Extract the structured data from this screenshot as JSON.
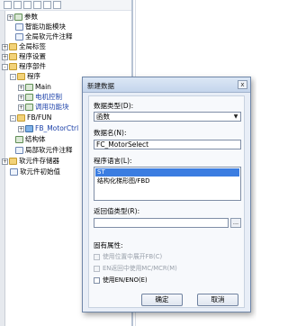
{
  "tree": {
    "items": [
      {
        "label": "参数",
        "depth": 1,
        "expander": "+",
        "icon": "grid-icon"
      },
      {
        "label": "智能功能模块",
        "depth": 1,
        "expander": "",
        "icon": "module-icon"
      },
      {
        "label": "全局软元件注释",
        "depth": 1,
        "expander": "",
        "icon": "doc-icon"
      },
      {
        "label": "全局标签",
        "depth": 0,
        "expander": "+",
        "icon": "folder-icon"
      },
      {
        "label": "程序设置",
        "depth": 0,
        "expander": "+",
        "icon": "folder-icon"
      },
      {
        "label": "程序部件",
        "depth": 0,
        "expander": "-",
        "icon": "folder-icon"
      },
      {
        "label": "程序",
        "depth": 1,
        "expander": "-",
        "icon": "folder-icon"
      },
      {
        "label": "Main",
        "depth": 2,
        "expander": "+",
        "icon": "program-icon"
      },
      {
        "label": "电机控制",
        "depth": 2,
        "expander": "+",
        "icon": "program-icon"
      },
      {
        "label": "调用功能块",
        "depth": 2,
        "expander": "+",
        "icon": "program-icon"
      },
      {
        "label": "FB/FUN",
        "depth": 1,
        "expander": "-",
        "icon": "folder-icon"
      },
      {
        "label": "FB_MotorCtrl",
        "depth": 2,
        "expander": "+",
        "icon": "fb-icon"
      },
      {
        "label": "结构体",
        "depth": 1,
        "expander": "",
        "icon": "struct-icon"
      },
      {
        "label": "局部软元件注释",
        "depth": 1,
        "expander": "",
        "icon": "doc-icon"
      },
      {
        "label": "软元件存储器",
        "depth": 0,
        "expander": "+",
        "icon": "folder-icon"
      },
      {
        "label": "软元件初始值",
        "depth": 0,
        "expander": "",
        "icon": "doc-icon"
      }
    ]
  },
  "dialog": {
    "title": "新建数据",
    "close_label": "x",
    "data_type_label": "数据类型(D):",
    "data_type_value": "函数",
    "data_name_label": "数据名(N):",
    "data_name_value": "FC_MotorSelect",
    "program_language_label": "程序语言(L):",
    "languages": [
      "ST",
      "结构化梯形图/FBD"
    ],
    "selected_language": "ST",
    "return_type_label": "返回值类型(R):",
    "return_type_value": "",
    "browse_label": "...",
    "fixed_attributes_label": "固有属性:",
    "checkboxes": [
      {
        "label": "使用位置中展开FB(C)",
        "enabled": false
      },
      {
        "label": "EN返回中使用MC/MCR(M)",
        "enabled": false
      },
      {
        "label": "使用EN/ENO(E)",
        "enabled": true
      }
    ],
    "ok_label": "确定",
    "cancel_label": "取消"
  }
}
